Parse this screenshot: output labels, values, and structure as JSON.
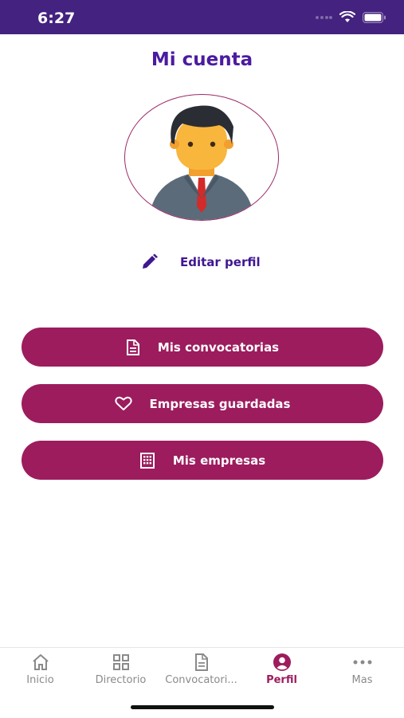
{
  "status_bar": {
    "time": "6:27",
    "icons": [
      "cellular-dots-icon",
      "wifi-icon",
      "battery-icon"
    ]
  },
  "page_title": "Mi cuenta",
  "profile": {
    "avatar": "person-avatar-icon",
    "edit_label": "Editar perfil",
    "edit_icon": "pencil-icon"
  },
  "actions": [
    {
      "label": "Mis convocatorias",
      "icon": "document-icon"
    },
    {
      "label": "Empresas guardadas",
      "icon": "heart-icon"
    },
    {
      "label": "Mis empresas",
      "icon": "building-icon"
    }
  ],
  "tabs": [
    {
      "label": "Inicio",
      "icon": "home-icon",
      "active": false
    },
    {
      "label": "Directorio",
      "icon": "grid-icon",
      "active": false
    },
    {
      "label": "Convocatori...",
      "icon": "document-icon",
      "active": false
    },
    {
      "label": "Perfil",
      "icon": "user-circle-icon",
      "active": true
    },
    {
      "label": "Mas",
      "icon": "more-dots-icon",
      "active": false
    }
  ],
  "colors": {
    "primary_purple": "#4b1ba0",
    "status_bar": "#44227f",
    "button_magenta": "#9c1c5e",
    "inactive_tab": "#8a8a8a"
  }
}
